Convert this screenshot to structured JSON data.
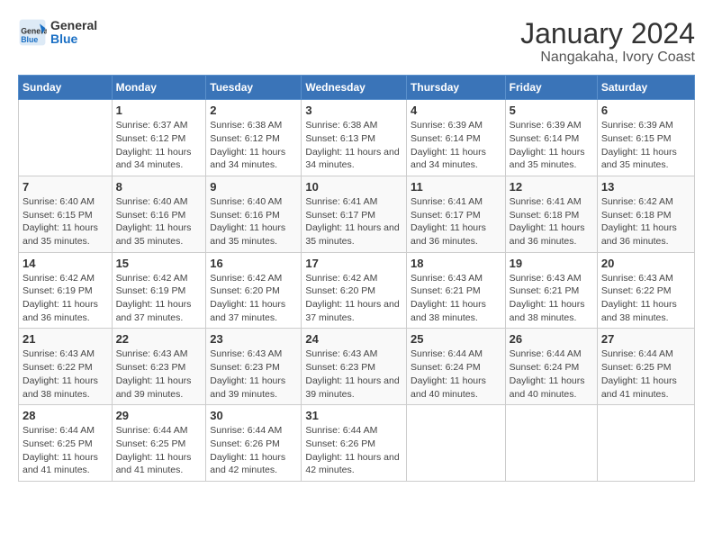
{
  "logo": {
    "text_general": "General",
    "text_blue": "Blue"
  },
  "title": "January 2024",
  "subtitle": "Nangakaha, Ivory Coast",
  "days_header": [
    "Sunday",
    "Monday",
    "Tuesday",
    "Wednesday",
    "Thursday",
    "Friday",
    "Saturday"
  ],
  "weeks": [
    [
      {
        "day": "",
        "sunrise": "",
        "sunset": "",
        "daylight": ""
      },
      {
        "day": "1",
        "sunrise": "Sunrise: 6:37 AM",
        "sunset": "Sunset: 6:12 PM",
        "daylight": "Daylight: 11 hours and 34 minutes."
      },
      {
        "day": "2",
        "sunrise": "Sunrise: 6:38 AM",
        "sunset": "Sunset: 6:12 PM",
        "daylight": "Daylight: 11 hours and 34 minutes."
      },
      {
        "day": "3",
        "sunrise": "Sunrise: 6:38 AM",
        "sunset": "Sunset: 6:13 PM",
        "daylight": "Daylight: 11 hours and 34 minutes."
      },
      {
        "day": "4",
        "sunrise": "Sunrise: 6:39 AM",
        "sunset": "Sunset: 6:14 PM",
        "daylight": "Daylight: 11 hours and 34 minutes."
      },
      {
        "day": "5",
        "sunrise": "Sunrise: 6:39 AM",
        "sunset": "Sunset: 6:14 PM",
        "daylight": "Daylight: 11 hours and 35 minutes."
      },
      {
        "day": "6",
        "sunrise": "Sunrise: 6:39 AM",
        "sunset": "Sunset: 6:15 PM",
        "daylight": "Daylight: 11 hours and 35 minutes."
      }
    ],
    [
      {
        "day": "7",
        "sunrise": "Sunrise: 6:40 AM",
        "sunset": "Sunset: 6:15 PM",
        "daylight": "Daylight: 11 hours and 35 minutes."
      },
      {
        "day": "8",
        "sunrise": "Sunrise: 6:40 AM",
        "sunset": "Sunset: 6:16 PM",
        "daylight": "Daylight: 11 hours and 35 minutes."
      },
      {
        "day": "9",
        "sunrise": "Sunrise: 6:40 AM",
        "sunset": "Sunset: 6:16 PM",
        "daylight": "Daylight: 11 hours and 35 minutes."
      },
      {
        "day": "10",
        "sunrise": "Sunrise: 6:41 AM",
        "sunset": "Sunset: 6:17 PM",
        "daylight": "Daylight: 11 hours and 35 minutes."
      },
      {
        "day": "11",
        "sunrise": "Sunrise: 6:41 AM",
        "sunset": "Sunset: 6:17 PM",
        "daylight": "Daylight: 11 hours and 36 minutes."
      },
      {
        "day": "12",
        "sunrise": "Sunrise: 6:41 AM",
        "sunset": "Sunset: 6:18 PM",
        "daylight": "Daylight: 11 hours and 36 minutes."
      },
      {
        "day": "13",
        "sunrise": "Sunrise: 6:42 AM",
        "sunset": "Sunset: 6:18 PM",
        "daylight": "Daylight: 11 hours and 36 minutes."
      }
    ],
    [
      {
        "day": "14",
        "sunrise": "Sunrise: 6:42 AM",
        "sunset": "Sunset: 6:19 PM",
        "daylight": "Daylight: 11 hours and 36 minutes."
      },
      {
        "day": "15",
        "sunrise": "Sunrise: 6:42 AM",
        "sunset": "Sunset: 6:19 PM",
        "daylight": "Daylight: 11 hours and 37 minutes."
      },
      {
        "day": "16",
        "sunrise": "Sunrise: 6:42 AM",
        "sunset": "Sunset: 6:20 PM",
        "daylight": "Daylight: 11 hours and 37 minutes."
      },
      {
        "day": "17",
        "sunrise": "Sunrise: 6:42 AM",
        "sunset": "Sunset: 6:20 PM",
        "daylight": "Daylight: 11 hours and 37 minutes."
      },
      {
        "day": "18",
        "sunrise": "Sunrise: 6:43 AM",
        "sunset": "Sunset: 6:21 PM",
        "daylight": "Daylight: 11 hours and 38 minutes."
      },
      {
        "day": "19",
        "sunrise": "Sunrise: 6:43 AM",
        "sunset": "Sunset: 6:21 PM",
        "daylight": "Daylight: 11 hours and 38 minutes."
      },
      {
        "day": "20",
        "sunrise": "Sunrise: 6:43 AM",
        "sunset": "Sunset: 6:22 PM",
        "daylight": "Daylight: 11 hours and 38 minutes."
      }
    ],
    [
      {
        "day": "21",
        "sunrise": "Sunrise: 6:43 AM",
        "sunset": "Sunset: 6:22 PM",
        "daylight": "Daylight: 11 hours and 38 minutes."
      },
      {
        "day": "22",
        "sunrise": "Sunrise: 6:43 AM",
        "sunset": "Sunset: 6:23 PM",
        "daylight": "Daylight: 11 hours and 39 minutes."
      },
      {
        "day": "23",
        "sunrise": "Sunrise: 6:43 AM",
        "sunset": "Sunset: 6:23 PM",
        "daylight": "Daylight: 11 hours and 39 minutes."
      },
      {
        "day": "24",
        "sunrise": "Sunrise: 6:43 AM",
        "sunset": "Sunset: 6:23 PM",
        "daylight": "Daylight: 11 hours and 39 minutes."
      },
      {
        "day": "25",
        "sunrise": "Sunrise: 6:44 AM",
        "sunset": "Sunset: 6:24 PM",
        "daylight": "Daylight: 11 hours and 40 minutes."
      },
      {
        "day": "26",
        "sunrise": "Sunrise: 6:44 AM",
        "sunset": "Sunset: 6:24 PM",
        "daylight": "Daylight: 11 hours and 40 minutes."
      },
      {
        "day": "27",
        "sunrise": "Sunrise: 6:44 AM",
        "sunset": "Sunset: 6:25 PM",
        "daylight": "Daylight: 11 hours and 41 minutes."
      }
    ],
    [
      {
        "day": "28",
        "sunrise": "Sunrise: 6:44 AM",
        "sunset": "Sunset: 6:25 PM",
        "daylight": "Daylight: 11 hours and 41 minutes."
      },
      {
        "day": "29",
        "sunrise": "Sunrise: 6:44 AM",
        "sunset": "Sunset: 6:25 PM",
        "daylight": "Daylight: 11 hours and 41 minutes."
      },
      {
        "day": "30",
        "sunrise": "Sunrise: 6:44 AM",
        "sunset": "Sunset: 6:26 PM",
        "daylight": "Daylight: 11 hours and 42 minutes."
      },
      {
        "day": "31",
        "sunrise": "Sunrise: 6:44 AM",
        "sunset": "Sunset: 6:26 PM",
        "daylight": "Daylight: 11 hours and 42 minutes."
      },
      {
        "day": "",
        "sunrise": "",
        "sunset": "",
        "daylight": ""
      },
      {
        "day": "",
        "sunrise": "",
        "sunset": "",
        "daylight": ""
      },
      {
        "day": "",
        "sunrise": "",
        "sunset": "",
        "daylight": ""
      }
    ]
  ]
}
